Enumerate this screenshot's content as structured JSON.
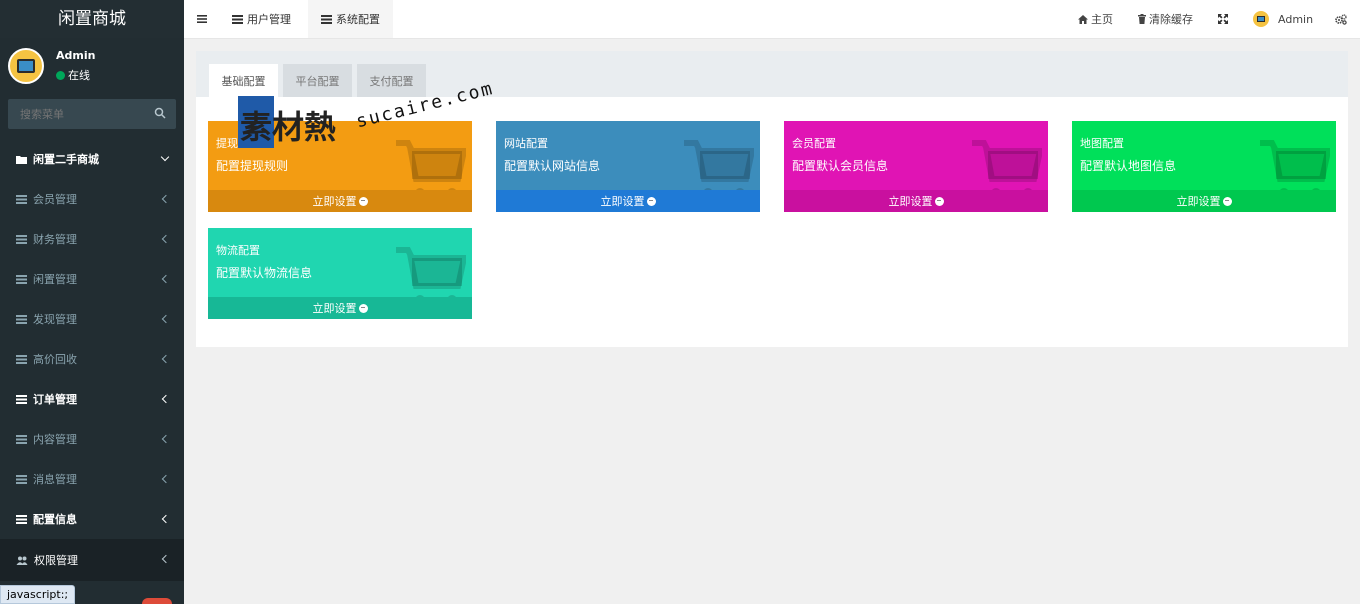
{
  "app": {
    "title": "闲置商城"
  },
  "user": {
    "name": "Admin",
    "status": "在线"
  },
  "search": {
    "placeholder": "搜索菜单"
  },
  "menu": {
    "section_label": "闲置二手商城",
    "items": [
      {
        "label": "会员管理"
      },
      {
        "label": "财务管理"
      },
      {
        "label": "闲置管理"
      },
      {
        "label": "发现管理"
      },
      {
        "label": "高价回收"
      },
      {
        "label": "订单管理"
      },
      {
        "label": "内容管理"
      },
      {
        "label": "消息管理"
      },
      {
        "label": "配置信息"
      }
    ],
    "permission_label": "权限管理"
  },
  "status_tip": "javascript:;",
  "topbar": {
    "tabs": [
      {
        "label": "用户管理"
      },
      {
        "label": "系统配置"
      }
    ],
    "home_label": "主页",
    "clear_cache_label": "清除缓存",
    "user_label": "Admin"
  },
  "config_tabs": [
    {
      "label": "基础配置"
    },
    {
      "label": "平台配置"
    },
    {
      "label": "支付配置"
    }
  ],
  "cards": [
    {
      "title": "提现",
      "desc": "配置提现规则",
      "action": "立即设置",
      "color": "#f39c12",
      "foot_color": "#d8890f"
    },
    {
      "title": "网站配置",
      "desc": "配置默认网站信息",
      "action": "立即设置",
      "color": "#3c8dbc",
      "foot_color": "#1f7ad6"
    },
    {
      "title": "会员配置",
      "desc": "配置默认会员信息",
      "action": "立即设置",
      "color": "#e014b4",
      "foot_color": "#c9109f"
    },
    {
      "title": "地图配置",
      "desc": "配置默认地图信息",
      "action": "立即设置",
      "color": "#00e05a",
      "foot_color": "#00c84f"
    },
    {
      "title": "物流配置",
      "desc": "配置默认物流信息",
      "action": "立即设置",
      "color": "#20d6b0",
      "foot_color": "#17b896"
    }
  ],
  "watermark": {
    "cn": "素材熱",
    "en": "sucaire.com"
  }
}
